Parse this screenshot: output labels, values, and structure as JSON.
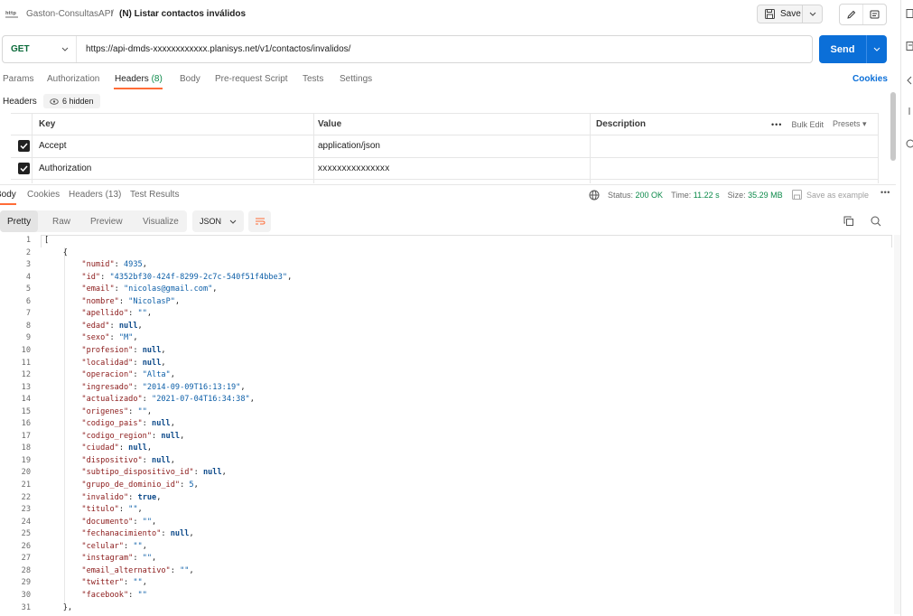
{
  "topbar": {
    "workspace": "Gaston-ConsultasAPI",
    "separator": "/",
    "request_title": "(N) Listar contactos inválidos",
    "save_label": "Save"
  },
  "request": {
    "method": "GET",
    "url": "https://api-dmds-xxxxxxxxxxxx.planisys.net/v1/contactos/invalidos/",
    "send_label": "Send"
  },
  "request_tabs": [
    {
      "label": "Params"
    },
    {
      "label": "Authorization"
    },
    {
      "label": "Headers",
      "count": "(8)"
    },
    {
      "label": "Body"
    },
    {
      "label": "Pre-request Script"
    },
    {
      "label": "Tests"
    },
    {
      "label": "Settings"
    }
  ],
  "cookies_link": "Cookies",
  "headers_section": {
    "label": "Headers",
    "hidden": "6 hidden",
    "columns": {
      "key": "Key",
      "value": "Value",
      "description": "Description"
    },
    "bulk_edit": "Bulk Edit",
    "presets": "Presets",
    "rows": [
      {
        "key": "Accept",
        "value": "application/json",
        "checked": true
      },
      {
        "key": "Authorization",
        "value": "xxxxxxxxxxxxxxx",
        "checked": true
      }
    ]
  },
  "response": {
    "tabs": [
      {
        "label": "Body"
      },
      {
        "label": "Cookies"
      },
      {
        "label": "Headers (13)"
      },
      {
        "label": "Test Results"
      }
    ],
    "status_label": "Status:",
    "status_value": "200 OK",
    "time_label": "Time:",
    "time_value": "11.22 s",
    "size_label": "Size:",
    "size_value": "35.29 MB",
    "save_example": "Save as example",
    "views": [
      "Pretty",
      "Raw",
      "Preview",
      "Visualize"
    ],
    "format": "JSON"
  },
  "code_lines": [
    {
      "n": "1",
      "t": "["
    },
    {
      "n": "2",
      "t": "    {"
    },
    {
      "n": "3",
      "k": "numid",
      "v": "4935",
      "vt": "n",
      "comma": true
    },
    {
      "n": "4",
      "k": "id",
      "v": "\"4352bf30-424f-8299-2c7c-540f51f4bbe3\"",
      "vt": "s",
      "comma": true
    },
    {
      "n": "5",
      "k": "email",
      "v": "\"nicolas@gmail.com\"",
      "vt": "s",
      "comma": true
    },
    {
      "n": "6",
      "k": "nombre",
      "v": "\"NicolasP\"",
      "vt": "s",
      "comma": true
    },
    {
      "n": "7",
      "k": "apellido",
      "v": "\"\"",
      "vt": "s",
      "comma": true
    },
    {
      "n": "8",
      "k": "edad",
      "v": "null",
      "vt": "b",
      "comma": true
    },
    {
      "n": "9",
      "k": "sexo",
      "v": "\"M\"",
      "vt": "s",
      "comma": true
    },
    {
      "n": "10",
      "k": "profesion",
      "v": "null",
      "vt": "b",
      "comma": true
    },
    {
      "n": "11",
      "k": "localidad",
      "v": "null",
      "vt": "b",
      "comma": true
    },
    {
      "n": "12",
      "k": "operacion",
      "v": "\"Alta\"",
      "vt": "s",
      "comma": true
    },
    {
      "n": "13",
      "k": "ingresado",
      "v": "\"2014-09-09T16:13:19\"",
      "vt": "s",
      "comma": true
    },
    {
      "n": "14",
      "k": "actualizado",
      "v": "\"2021-07-04T16:34:38\"",
      "vt": "s",
      "comma": true
    },
    {
      "n": "15",
      "k": "origenes",
      "v": "\"\"",
      "vt": "s",
      "comma": true
    },
    {
      "n": "16",
      "k": "codigo_pais",
      "v": "null",
      "vt": "b",
      "comma": true
    },
    {
      "n": "17",
      "k": "codigo_region",
      "v": "null",
      "vt": "b",
      "comma": true
    },
    {
      "n": "18",
      "k": "ciudad",
      "v": "null",
      "vt": "b",
      "comma": true
    },
    {
      "n": "19",
      "k": "dispositivo",
      "v": "null",
      "vt": "b",
      "comma": true
    },
    {
      "n": "20",
      "k": "subtipo_dispositivo_id",
      "v": "null",
      "vt": "b",
      "comma": true
    },
    {
      "n": "21",
      "k": "grupo_de_dominio_id",
      "v": "5",
      "vt": "n",
      "comma": true
    },
    {
      "n": "22",
      "k": "invalido",
      "v": "true",
      "vt": "b",
      "comma": true
    },
    {
      "n": "23",
      "k": "titulo",
      "v": "\"\"",
      "vt": "s",
      "comma": true
    },
    {
      "n": "24",
      "k": "documento",
      "v": "\"\"",
      "vt": "s",
      "comma": true
    },
    {
      "n": "25",
      "k": "fechanacimiento",
      "v": "null",
      "vt": "b",
      "comma": true
    },
    {
      "n": "26",
      "k": "celular",
      "v": "\"\"",
      "vt": "s",
      "comma": true
    },
    {
      "n": "27",
      "k": "instagram",
      "v": "\"\"",
      "vt": "s",
      "comma": true
    },
    {
      "n": "28",
      "k": "email_alternativo",
      "v": "\"\"",
      "vt": "s",
      "comma": true
    },
    {
      "n": "29",
      "k": "twitter",
      "v": "\"\"",
      "vt": "s",
      "comma": true
    },
    {
      "n": "30",
      "k": "facebook",
      "v": "\"\"",
      "vt": "s",
      "comma": false
    },
    {
      "n": "31",
      "t": "    },"
    }
  ],
  "colors": {
    "accent": "#ff6c37",
    "send": "#0b6fd8",
    "method": "#0c6b3b",
    "status_ok": "#0c8a4a",
    "json_key": "#8b1a1a",
    "json_value": "#0d5fa8"
  }
}
